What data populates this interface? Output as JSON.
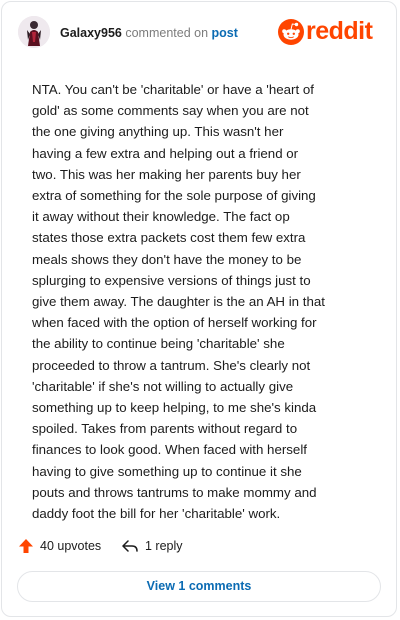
{
  "header": {
    "username": "Galaxy956",
    "commented_on": "commented on",
    "post_link": "post",
    "brand": "reddit",
    "brand_color": "#ff4500"
  },
  "comment": {
    "body": "NTA. You can't be 'charitable' or have a 'heart of\ngold' as some comments say when you are not\nthe one giving anything up. This wasn't her\nhaving a few extra and helping out a friend or\ntwo. This was her making her parents buy her\nextra of something for the sole purpose of giving\nit away without their knowledge. The fact op\nstates those extra packets cost them few extra\nmeals shows they don't have the money to be\nsplurging to expensive versions of things just to\ngive them away. The daughter is the an AH in that\nwhen faced with the option of herself working for\nthe ability to continue being 'charitable' she\nproceeded to throw a tantrum. She's clearly not\n'charitable' if she's not willing to actually give\nsomething up to keep helping, to me she's kinda\nspoiled. Takes from parents without regard to\nfinances to look good. When faced with herself\nhaving to give something up to continue it she\npouts and throws tantrums to make mommy and\ndaddy foot the bill for her 'charitable' work."
  },
  "actions": {
    "upvotes": "40 upvotes",
    "replies": "1 reply",
    "upvote_icon": "upvote-arrow-icon",
    "reply_icon": "reply-arrow-icon"
  },
  "footer": {
    "view_comments": "View 1 comments"
  }
}
